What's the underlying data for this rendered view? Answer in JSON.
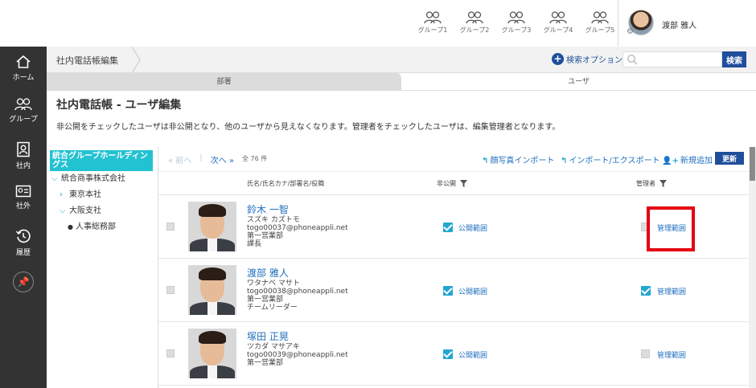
{
  "groups": [
    {
      "label": "グループ1"
    },
    {
      "label": "グループ2"
    },
    {
      "label": "グループ3"
    },
    {
      "label": "グループ4"
    },
    {
      "label": "グループ5"
    }
  ],
  "user": {
    "name": "渡部 雅人"
  },
  "sidebar": {
    "items": [
      {
        "label": "ホーム",
        "icon": "home-icon"
      },
      {
        "label": "グループ",
        "icon": "group-icon"
      },
      {
        "label": "社内",
        "icon": "phonebook-icon"
      },
      {
        "label": "社外",
        "icon": "contact-card-icon"
      },
      {
        "label": "履歴",
        "icon": "history-icon"
      }
    ],
    "pin_icon": "pin-icon"
  },
  "breadcrumb": {
    "label": "社内電話帳編集"
  },
  "search": {
    "option_label": "検索オプション",
    "placeholder": "",
    "button_label": "検索"
  },
  "tabs": [
    {
      "label": "部署"
    },
    {
      "label": "ユーザ"
    }
  ],
  "page": {
    "title": "社内電話帳 - ユーザ編集",
    "description": "非公開をチェックしたユーザは非公開となり、他のユーザから見えなくなります。管理者をチェックしたユーザは、編集管理者となります。"
  },
  "tree": {
    "root": "統合グループホールディングス",
    "nodes": [
      {
        "label": "統合商事株式会社",
        "expanded": true
      },
      {
        "label": "東京本社",
        "expanded": false
      },
      {
        "label": "大阪支社",
        "expanded": true
      },
      {
        "label": "人事総務部"
      }
    ]
  },
  "toolbar": {
    "prev": "前へ",
    "next": "次へ",
    "count": "全 76 件",
    "photo_import": "顔写真インポート",
    "import_export": "インポート/エクスポート",
    "add_new": "新規追加",
    "update": "更新"
  },
  "columns": {
    "name": "氏名/氏名カナ/部署名/役職",
    "private": "非公開",
    "admin": "管理者"
  },
  "rows": [
    {
      "name": "鈴木 一智",
      "kana": "スズキ カズトモ",
      "email": "togo00037@phoneappli.net",
      "dept": "第一営業部",
      "role": "課長",
      "private_checked": true,
      "private_link": "公開範囲",
      "admin_checked": false,
      "admin_link": "管理範囲"
    },
    {
      "name": "渡部 雅人",
      "kana": "ワタナベ マサト",
      "email": "togo00038@phoneappli.net",
      "dept": "第一営業部",
      "role": "チームリーダー",
      "private_checked": true,
      "private_link": "公開範囲",
      "admin_checked": true,
      "admin_link": "管理範囲"
    },
    {
      "name": "塚田 正晃",
      "kana": "ツカダ マサアキ",
      "email": "togo00039@phoneappli.net",
      "dept": "第一営業部",
      "role": "",
      "private_checked": true,
      "private_link": "公開範囲",
      "admin_checked": false,
      "admin_link": "管理範囲"
    }
  ],
  "colors": {
    "accent": "#1f4e9c",
    "link": "#1f6fbf",
    "tree_root": "#23c2d1",
    "checkbox": "#23a6d1",
    "highlight": "#e60012",
    "sidebar": "#333333"
  }
}
